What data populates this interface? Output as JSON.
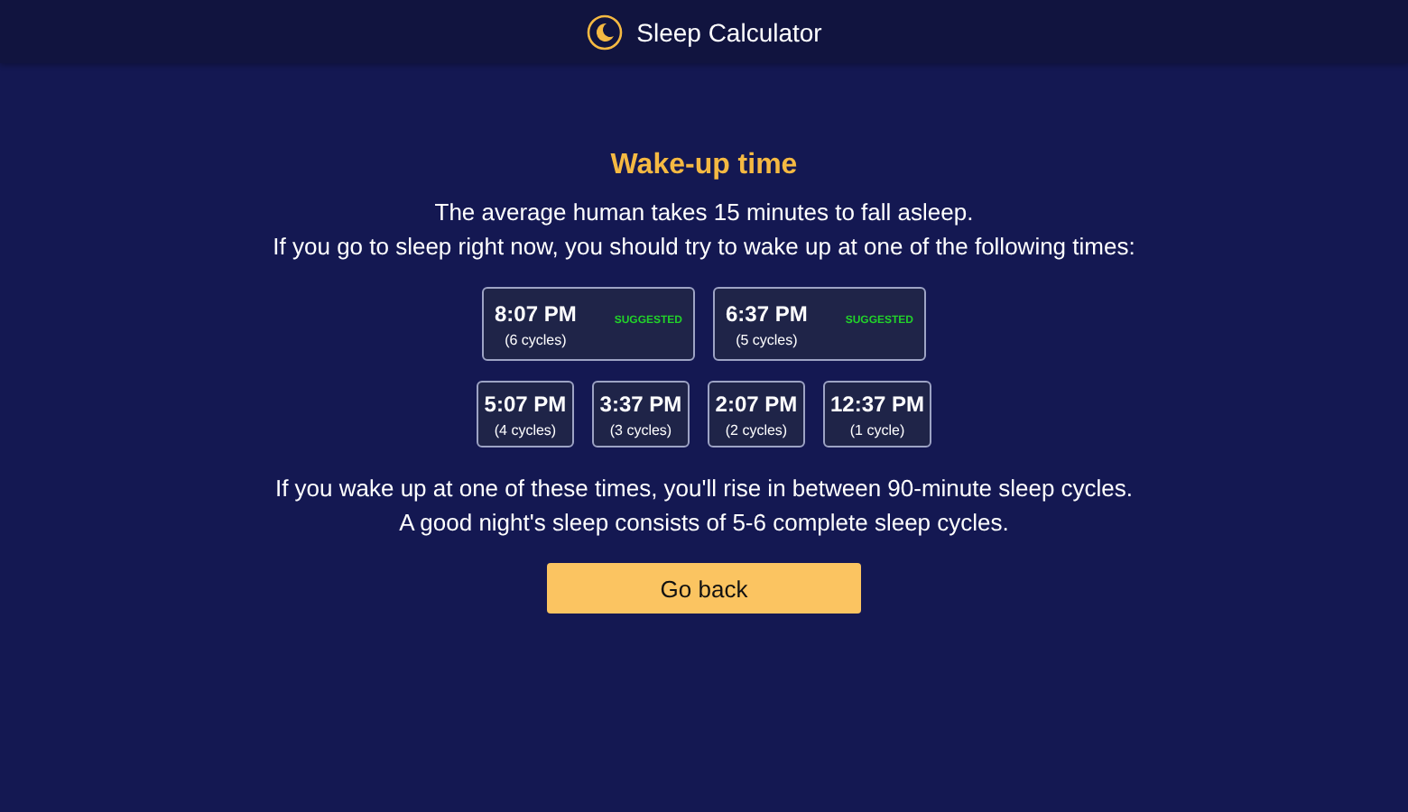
{
  "header": {
    "title": "Sleep Calculator"
  },
  "heading": "Wake-up time",
  "intro": [
    "The average human takes 15 minutes to fall asleep.",
    "If you go to sleep right now, you should try to wake up at one of the following times:"
  ],
  "times": [
    {
      "time": "8:07 PM",
      "cycles": "(6 cycles)",
      "badge": "SUGGESTED"
    },
    {
      "time": "6:37 PM",
      "cycles": "(5 cycles)",
      "badge": "SUGGESTED"
    },
    {
      "time": "5:07 PM",
      "cycles": "(4 cycles)"
    },
    {
      "time": "3:37 PM",
      "cycles": "(3 cycles)"
    },
    {
      "time": "2:07 PM",
      "cycles": "(2 cycles)"
    },
    {
      "time": "12:37 PM",
      "cycles": "(1 cycle)"
    }
  ],
  "outro": [
    "If you wake up at one of these times, you'll rise in between 90-minute sleep cycles.",
    "A good night's sleep consists of 5-6 complete sleep cycles."
  ],
  "button": "Go back"
}
